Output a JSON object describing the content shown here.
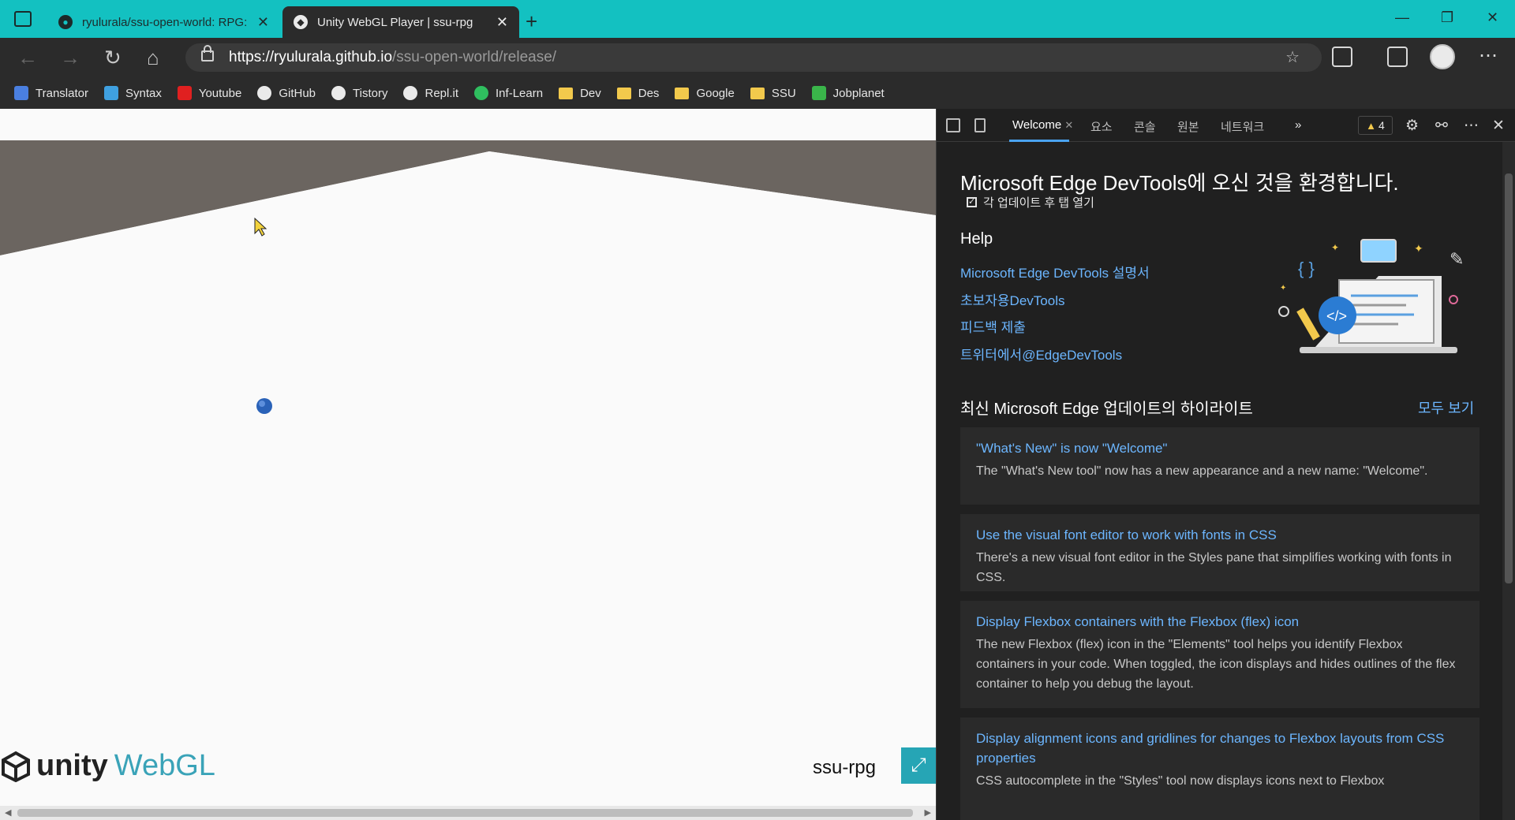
{
  "browser": {
    "tabs": [
      {
        "title": "ryulurala/ssu-open-world: RPG: F",
        "active": false
      },
      {
        "title": "Unity WebGL Player | ssu-rpg",
        "active": true
      }
    ],
    "url_host": "https://ryulurala.github.io",
    "url_path": "/ssu-open-world/release/",
    "bookmarks": [
      {
        "label": "Translator",
        "icon": "translator-icon",
        "color": "#4a7fe0"
      },
      {
        "label": "Syntax",
        "icon": "syntax-icon",
        "color": "#3fa0e0"
      },
      {
        "label": "Youtube",
        "icon": "youtube-icon",
        "color": "#e02020"
      },
      {
        "label": "GitHub",
        "icon": "github-icon",
        "color": "#eaeaea"
      },
      {
        "label": "Tistory",
        "icon": "tistory-icon",
        "color": "#eaeaea"
      },
      {
        "label": "Repl.it",
        "icon": "replit-icon",
        "color": "#eaeaea"
      },
      {
        "label": "Inf-Learn",
        "icon": "inflearn-icon",
        "color": "#2fbf5f"
      },
      {
        "label": "Dev",
        "icon": "folder-icon",
        "color": "#f2c94c"
      },
      {
        "label": "Des",
        "icon": "folder-icon",
        "color": "#f2c94c"
      },
      {
        "label": "Google",
        "icon": "folder-icon",
        "color": "#f2c94c"
      },
      {
        "label": "SSU",
        "icon": "folder-icon",
        "color": "#f2c94c"
      },
      {
        "label": "Jobplanet",
        "icon": "jobplanet-icon",
        "color": "#3ab54a"
      }
    ]
  },
  "game": {
    "logo_unity": "unity",
    "logo_webgl": "WebGL",
    "title": "ssu-rpg"
  },
  "devtools": {
    "tabs": [
      {
        "label": "Welcome",
        "active": true
      },
      {
        "label": "요소"
      },
      {
        "label": "콘솔"
      },
      {
        "label": "원본"
      },
      {
        "label": "네트워크"
      }
    ],
    "warning_count": "4",
    "welcome_title": "Microsoft Edge DevTools에 오신 것을 환경합니다.",
    "open_after_update": "각 업데이트 후 탭 열기",
    "help_heading": "Help",
    "help_links": [
      "Microsoft Edge DevTools 설명서",
      "초보자용DevTools",
      "피드백 제출",
      "트위터에서@EdgeDevTools"
    ],
    "highlights_heading": "최신 Microsoft Edge 업데이트의 하이라이트",
    "view_all": "모두 보기",
    "cards": [
      {
        "title": "\"What's New\" is now \"Welcome\"",
        "body": "The \"What's New tool\" now has a new appearance and a new name: \"Welcome\"."
      },
      {
        "title": "Use the visual font editor to work with fonts in CSS",
        "body": "There's a new visual font editor in the Styles pane that simplifies working with fonts in CSS."
      },
      {
        "title": "Display Flexbox containers with the Flexbox (flex) icon",
        "body": "The new Flexbox (flex) icon in the \"Elements\" tool helps you identify Flexbox containers in your code. When toggled, the icon displays and hides outlines of the flex container to help you debug the layout."
      },
      {
        "title": "Display alignment icons and gridlines for changes to Flexbox layouts from CSS properties",
        "body": "CSS autocomplete in the \"Styles\" tool now displays icons next to Flexbox"
      }
    ]
  },
  "colors": {
    "titlebar": "#13c1c1",
    "accent_link": "#6cb6ff",
    "webgl_teal": "#3aa3b8",
    "ground": "#6b6560"
  }
}
